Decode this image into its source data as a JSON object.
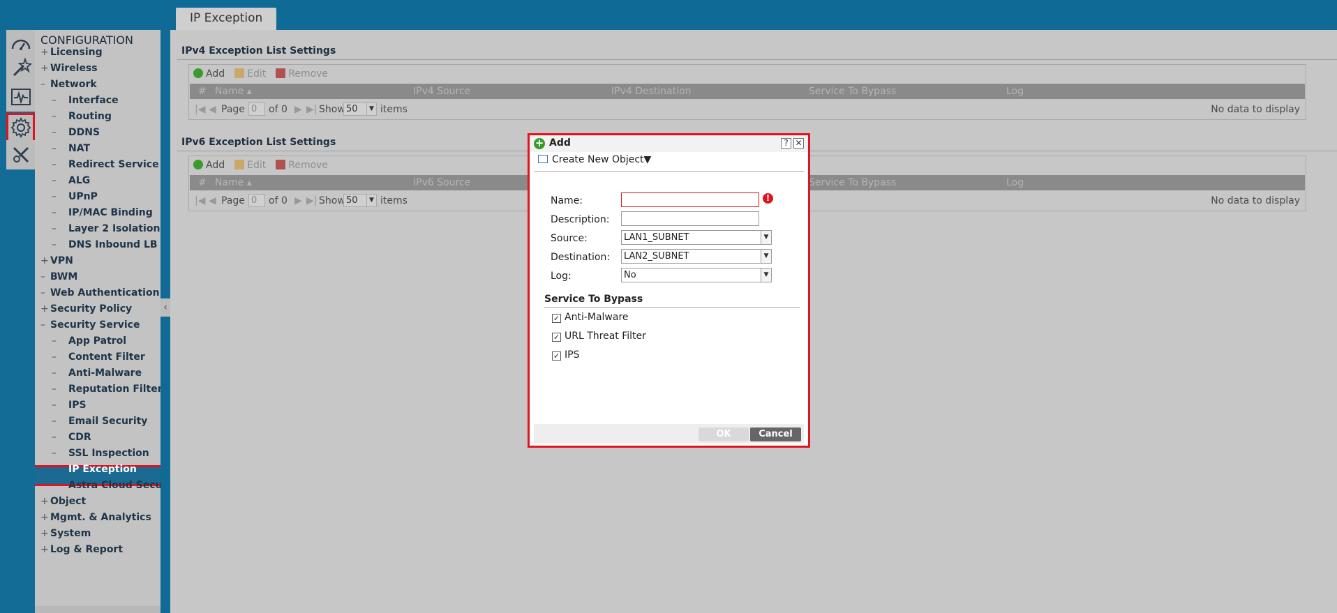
{
  "header": {
    "tab": "IP Exception"
  },
  "nav": {
    "title": "CONFIGURATION",
    "items": [
      {
        "sym": "+",
        "label": "Licensing",
        "level": 0
      },
      {
        "sym": "+",
        "label": "Wireless",
        "level": 0
      },
      {
        "sym": "–",
        "label": "Network",
        "level": 0
      },
      {
        "sym": "–",
        "label": "Interface",
        "level": 1
      },
      {
        "sym": "–",
        "label": "Routing",
        "level": 1
      },
      {
        "sym": "–",
        "label": "DDNS",
        "level": 1
      },
      {
        "sym": "–",
        "label": "NAT",
        "level": 1
      },
      {
        "sym": "–",
        "label": "Redirect Service",
        "level": 1
      },
      {
        "sym": "–",
        "label": "ALG",
        "level": 1
      },
      {
        "sym": "–",
        "label": "UPnP",
        "level": 1
      },
      {
        "sym": "–",
        "label": "IP/MAC Binding",
        "level": 1
      },
      {
        "sym": "–",
        "label": "Layer 2 Isolation",
        "level": 1
      },
      {
        "sym": "–",
        "label": "DNS Inbound LB",
        "level": 1
      },
      {
        "sym": "+",
        "label": "VPN",
        "level": 0
      },
      {
        "sym": "–",
        "label": "BWM",
        "level": 0
      },
      {
        "sym": "–",
        "label": "Web Authentication",
        "level": 0
      },
      {
        "sym": "+",
        "label": "Security Policy",
        "level": 0
      },
      {
        "sym": "–",
        "label": "Security Service",
        "level": 0
      },
      {
        "sym": "–",
        "label": "App Patrol",
        "level": 1
      },
      {
        "sym": "–",
        "label": "Content Filter",
        "level": 1
      },
      {
        "sym": "–",
        "label": "Anti-Malware",
        "level": 1
      },
      {
        "sym": "–",
        "label": "Reputation Filter",
        "level": 1
      },
      {
        "sym": "–",
        "label": "IPS",
        "level": 1
      },
      {
        "sym": "–",
        "label": "Email Security",
        "level": 1
      },
      {
        "sym": "–",
        "label": "CDR",
        "level": 1
      },
      {
        "sym": "–",
        "label": "SSL Inspection",
        "level": 1
      },
      {
        "sym": "–",
        "label": "IP Exception",
        "level": 1,
        "selected": true
      },
      {
        "sym": "–",
        "label": "Astra Cloud Security",
        "level": 1
      },
      {
        "sym": "+",
        "label": "Object",
        "level": 0
      },
      {
        "sym": "+",
        "label": "Mgmt. & Analytics",
        "level": 0
      },
      {
        "sym": "+",
        "label": "System",
        "level": 0
      },
      {
        "sym": "+",
        "label": "Log & Report",
        "level": 0
      }
    ]
  },
  "ipv4": {
    "title": "IPv4 Exception List Settings",
    "toolbar": {
      "add": "Add",
      "edit": "Edit",
      "remove": "Remove"
    },
    "columns": [
      "#",
      "Name ▴",
      "IPv4 Source",
      "IPv4 Destination",
      "Service To Bypass",
      "Log"
    ],
    "pager": {
      "page_label": "Page",
      "page_value": "0",
      "of": "of 0",
      "show": "Show",
      "show_value": "50",
      "items": "items",
      "empty": "No data to display"
    }
  },
  "ipv6": {
    "title": "IPv6 Exception List Settings",
    "toolbar": {
      "add": "Add",
      "edit": "Edit",
      "remove": "Remove"
    },
    "columns": [
      "#",
      "Name ▴",
      "IPv6 Source",
      "",
      "Service To Bypass",
      "Log"
    ],
    "pager": {
      "page_label": "Page",
      "page_value": "0",
      "of": "of 0",
      "show": "Show",
      "show_value": "50",
      "items": "items",
      "empty": "No data to display"
    }
  },
  "modal": {
    "title": "Add",
    "help": "?",
    "close": "✕",
    "create_new_object": "Create New Object▼",
    "fields": {
      "name_label": "Name:",
      "name_value": "",
      "description_label": "Description:",
      "description_value": "",
      "source_label": "Source:",
      "source_value": "LAN1_SUBNET",
      "destination_label": "Destination:",
      "destination_value": "LAN2_SUBNET",
      "log_label": "Log:",
      "log_value": "No"
    },
    "service_title": "Service To Bypass",
    "services": [
      {
        "label": "Anti-Malware",
        "checked": true
      },
      {
        "label": "URL Threat Filter",
        "checked": true
      },
      {
        "label": "IPS",
        "checked": true
      }
    ],
    "ok": "OK",
    "cancel": "Cancel"
  }
}
